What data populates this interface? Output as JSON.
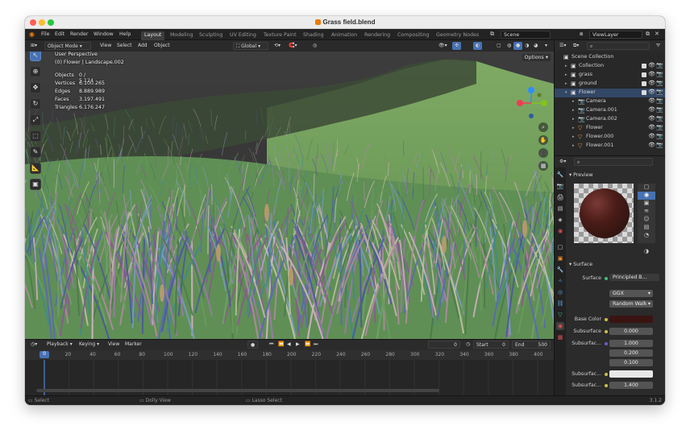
{
  "window": {
    "title": "Grass field.blend",
    "traffic_colors": [
      "#ff5f57",
      "#febc2e",
      "#28c840"
    ]
  },
  "menu": [
    "File",
    "Edit",
    "Render",
    "Window",
    "Help"
  ],
  "workspaces": {
    "tabs": [
      "Layout",
      "Modeling",
      "Sculpting",
      "UV Editing",
      "Texture Paint",
      "Shading",
      "Animation",
      "Rendering",
      "Compositing",
      "Geometry Nodes"
    ],
    "active_index": 0
  },
  "scene": {
    "label": "Scene"
  },
  "view_layer": {
    "label": "ViewLayer"
  },
  "viewport_header": {
    "mode": "Object Mode",
    "view": "View",
    "select": "Select",
    "add": "Add",
    "object": "Object",
    "orientation": "Global"
  },
  "viewport": {
    "perspective": "User Perspective",
    "context": "(0) Flower | Landscape.002",
    "options": "Options",
    "stats": [
      {
        "label": "Objects",
        "value": "0 / 5.124"
      },
      {
        "label": "Vertices",
        "value": "6.100.265"
      },
      {
        "label": "Edges",
        "value": "8.889.989"
      },
      {
        "label": "Faces",
        "value": "3.197.491"
      },
      {
        "label": "Triangles",
        "value": "6.176.247"
      }
    ],
    "tools": [
      "cursor-icon",
      "select-icon",
      "move-icon",
      "rotate-icon",
      "scale-icon",
      "transform-icon",
      "annotate-icon",
      "measure-icon",
      "add-cube-icon"
    ],
    "tool_glyphs": [
      "↖",
      "⊕",
      "✥",
      "↻",
      "⤢",
      "⬚",
      "✎",
      "📐",
      "▣"
    ],
    "gizmo": {
      "x_color": "#f23a52",
      "y_color": "#82c41a",
      "z_color": "#2c8fff"
    }
  },
  "outliner": {
    "rows": [
      {
        "name": "Scene Collection",
        "indent": 0,
        "icon": "collection"
      },
      {
        "name": "Collection",
        "indent": 1,
        "icon": "collection"
      },
      {
        "name": "grass",
        "indent": 1,
        "icon": "collection"
      },
      {
        "name": "ground",
        "indent": 1,
        "icon": "collection"
      },
      {
        "name": "Flower",
        "indent": 1,
        "icon": "collection"
      },
      {
        "name": "Camera",
        "indent": 2,
        "icon": "camera"
      },
      {
        "name": "Camera.001",
        "indent": 2,
        "icon": "camera"
      },
      {
        "name": "Camera.002",
        "indent": 2,
        "icon": "camera"
      },
      {
        "name": "Flower",
        "indent": 2,
        "icon": "mesh"
      },
      {
        "name": "Flower.000",
        "indent": 2,
        "icon": "mesh"
      },
      {
        "name": "Flower.001",
        "indent": 2,
        "icon": "mesh"
      }
    ]
  },
  "properties": {
    "preview_label": "Preview",
    "surface_label": "Surface",
    "surface_prop": "Surface",
    "surface_shader": "Principled B...",
    "distribution": "GGX",
    "subsurface_method": "Random Walk",
    "fields": [
      {
        "label": "Base Color",
        "value": "",
        "color": "#3a1412"
      },
      {
        "label": "Subsurface",
        "value": "0.000"
      },
      {
        "label": "Subsurfac...",
        "value": "1.000"
      },
      {
        "label": "",
        "value": "0.200"
      },
      {
        "label": "",
        "value": "0.100"
      },
      {
        "label": "Subsurfac...",
        "value": "",
        "color": "#e8e8e8"
      },
      {
        "label": "Subsurfac...",
        "value": "1.400"
      }
    ]
  },
  "timeline": {
    "menus": [
      "Playback",
      "Keying",
      "View",
      "Marker"
    ],
    "current_frame": "0",
    "start_label": "Start",
    "start": "0",
    "end_label": "End",
    "end": "500",
    "ticks": [
      "0",
      "20",
      "40",
      "60",
      "80",
      "100",
      "120",
      "140",
      "160",
      "180",
      "200",
      "220",
      "240",
      "260",
      "280",
      "300",
      "320",
      "340",
      "360",
      "380",
      "400"
    ]
  },
  "statusbar": {
    "select": "Select",
    "dolly": "Dolly View",
    "lasso": "Lasso Select",
    "version": "3.1.2"
  }
}
